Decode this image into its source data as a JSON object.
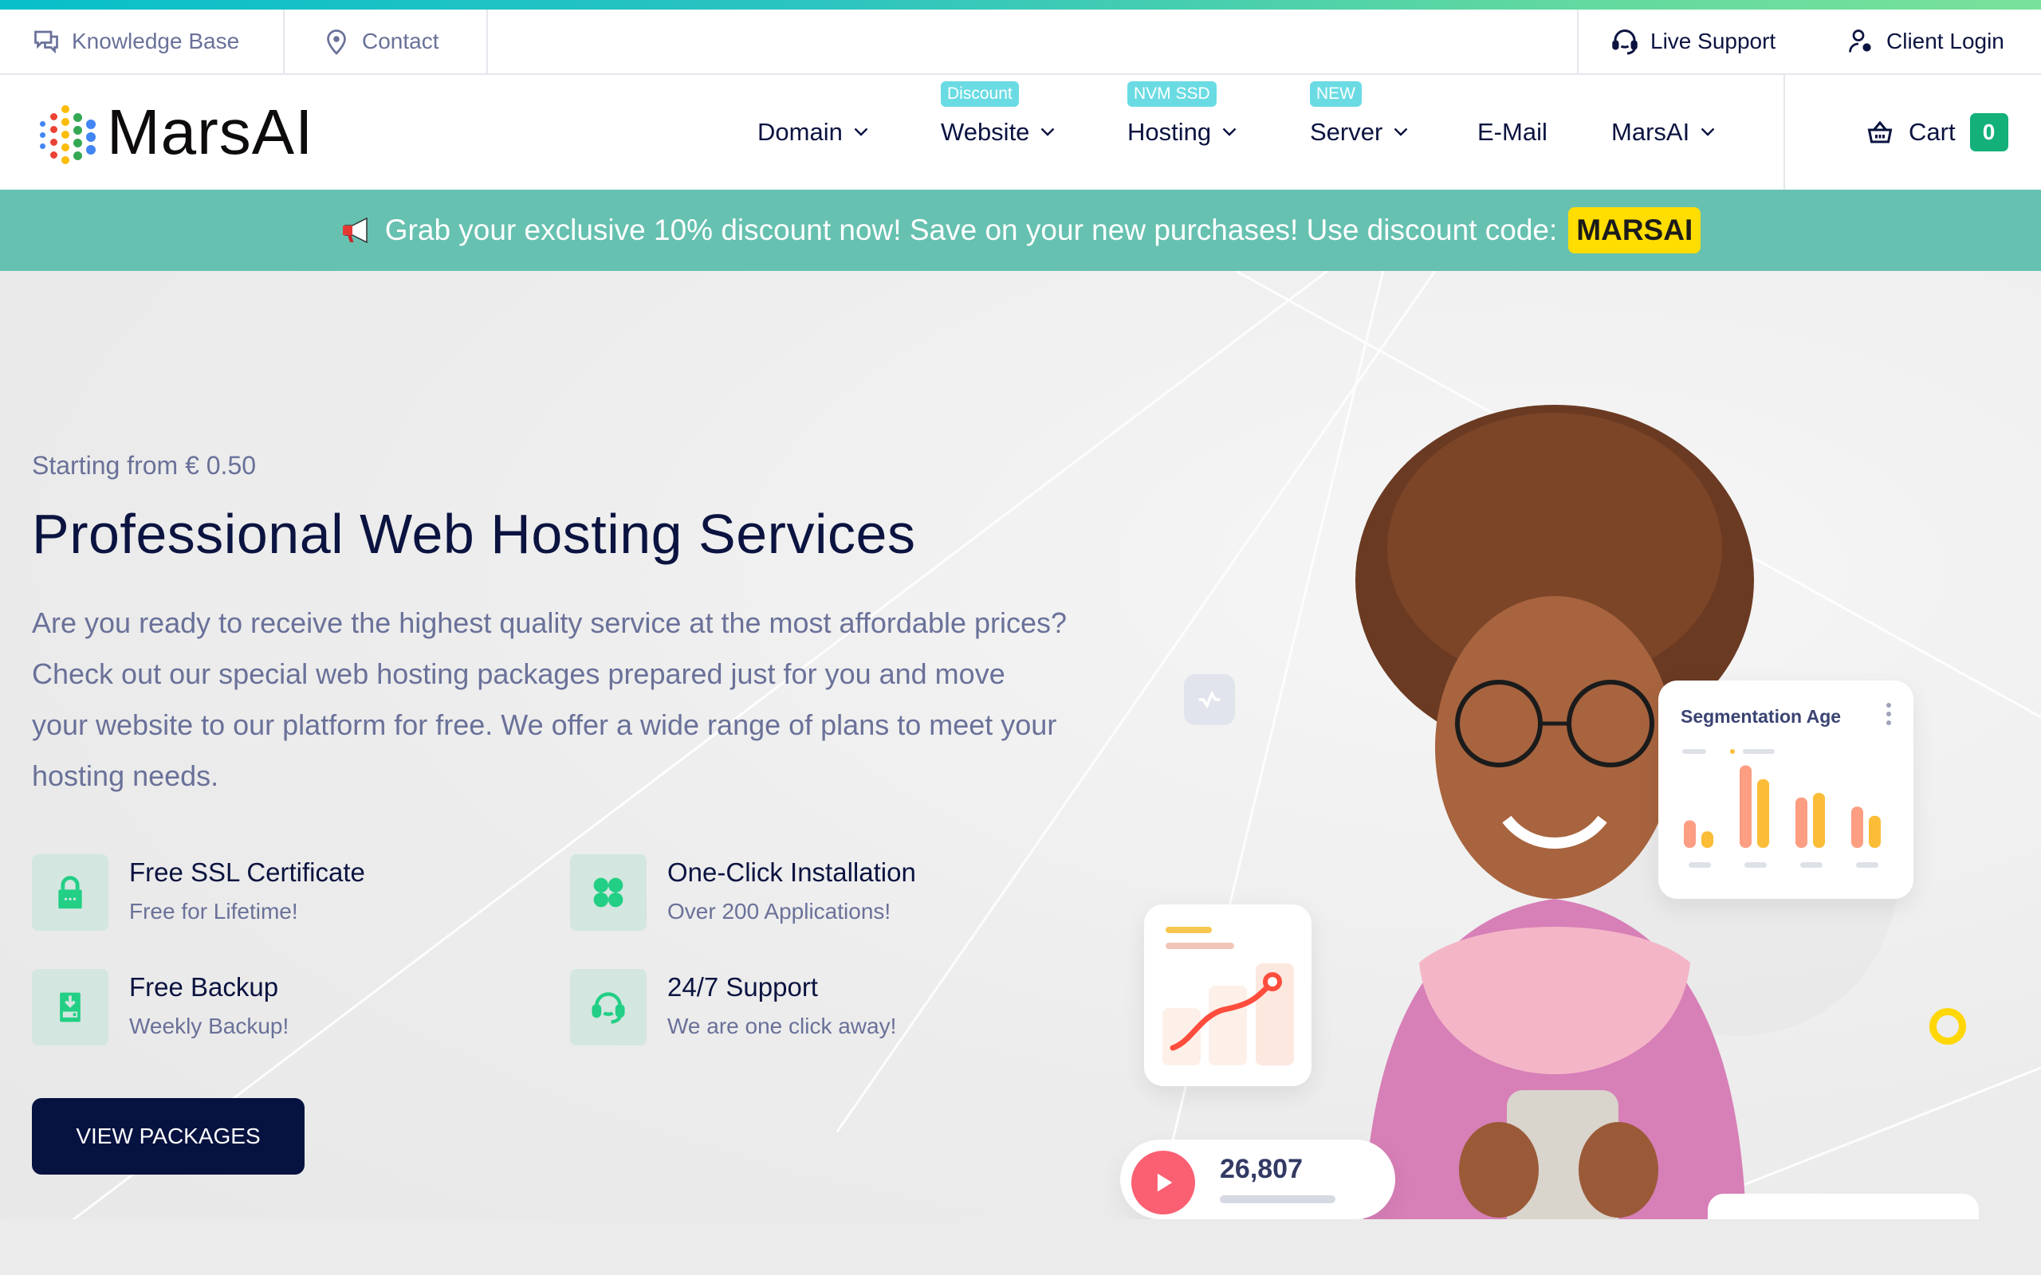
{
  "utility_bar": {
    "left_links": [
      {
        "label": "Knowledge Base",
        "icon": "chat-bubbles-icon"
      },
      {
        "label": "Contact",
        "icon": "map-pin-icon"
      }
    ],
    "right_links": [
      {
        "label": "Live Support",
        "icon": "headset-icon"
      },
      {
        "label": "Client Login",
        "icon": "user-gear-icon"
      }
    ]
  },
  "brand": {
    "name": "MarsAI"
  },
  "nav": {
    "items": [
      {
        "label": "Domain",
        "badge": null,
        "has_dropdown": true
      },
      {
        "label": "Website",
        "badge": "Discount",
        "has_dropdown": true
      },
      {
        "label": "Hosting",
        "badge": "NVM SSD",
        "has_dropdown": true
      },
      {
        "label": "Server",
        "badge": "NEW",
        "has_dropdown": true
      },
      {
        "label": "E-Mail",
        "badge": null,
        "has_dropdown": false
      },
      {
        "label": "MarsAI",
        "badge": null,
        "has_dropdown": true
      }
    ],
    "cart": {
      "label": "Cart",
      "count": "0"
    }
  },
  "promo": {
    "text": "Grab your exclusive 10% discount now! Save on your new purchases! Use discount code:",
    "code": "MARSAI",
    "icon": "megaphone-icon"
  },
  "hero": {
    "subtitle": "Starting from € 0.50",
    "title": "Professional Web Hosting Services",
    "description": "Are you ready to receive the highest quality service at the most affordable prices? Check out our special web hosting packages prepared just for you and move your website to our platform for free. We offer a wide range of plans to meet your hosting needs.",
    "features": [
      {
        "title": "Free SSL Certificate",
        "text": "Free for Lifetime!",
        "icon": "lock-icon"
      },
      {
        "title": "One-Click Installation",
        "text": "Over 200 Applications!",
        "icon": "apps-grid-icon"
      },
      {
        "title": "Free Backup",
        "text": "Weekly Backup!",
        "icon": "backup-download-icon"
      },
      {
        "title": "24/7 Support",
        "text": "We are one click away!",
        "icon": "headset-icon"
      }
    ],
    "cta_label": "VIEW PACKAGES"
  },
  "visual": {
    "segmentation_card_title": "Segmentation Age",
    "segmentation_bars": [
      {
        "a": 0.3,
        "b": 0.18
      },
      {
        "a": 0.9,
        "b": 0.75
      },
      {
        "a": 0.55,
        "b": 0.6
      },
      {
        "a": 0.45,
        "b": 0.35
      }
    ],
    "views_count": "26,807"
  },
  "colors": {
    "accent_teal": "#67c1b0",
    "badge_cyan": "#6adbe3",
    "cart_green": "#14b07a",
    "code_yellow": "#ffdd00",
    "navy": "#061240",
    "feature_green": "#22cf85"
  }
}
